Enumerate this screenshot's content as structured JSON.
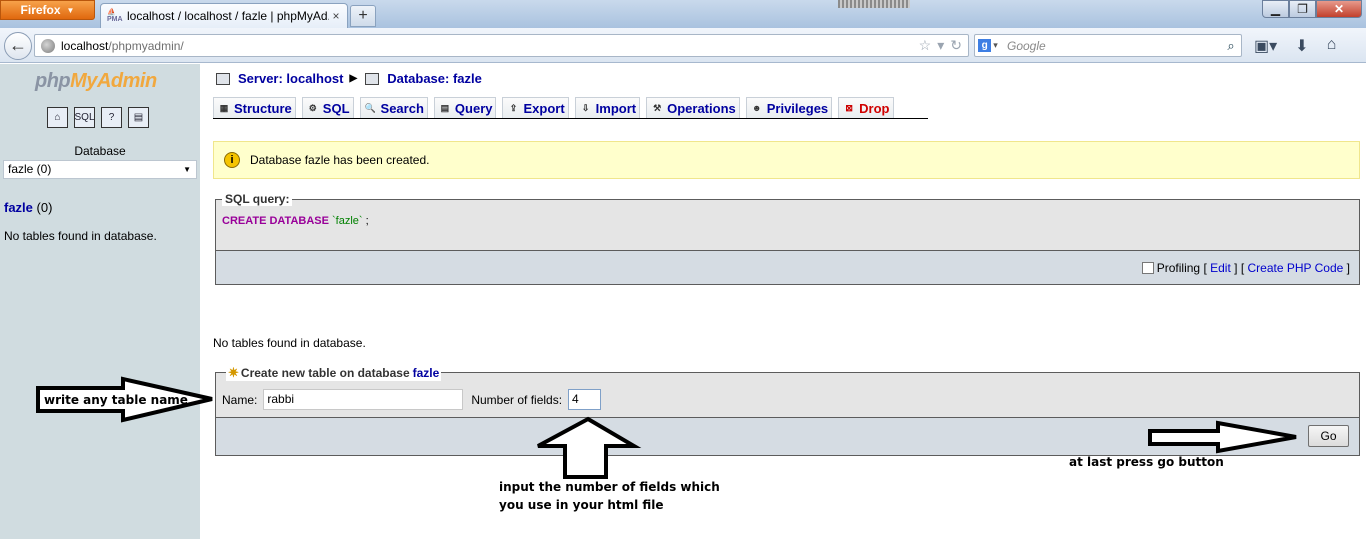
{
  "browser": {
    "app_button": "Firefox",
    "tab_title": "localhost / localhost / fazle | phpMyAd...",
    "new_tab": "+",
    "url_host": "localhost",
    "url_path": "/phpmyadmin/",
    "search_placeholder": "Google",
    "window_controls": [
      "minimize-icon",
      "maximize-icon",
      "close-icon"
    ]
  },
  "sidebar": {
    "logo_php": "php",
    "logo_my": "MyAdmin",
    "icons": [
      "home-icon",
      "sql-icon",
      "query-window-icon",
      "docs-icon"
    ],
    "database_label": "Database",
    "database_selected": "fazle (0)",
    "db_link": "fazle",
    "db_count": "(0)",
    "no_tables": "No tables found in database."
  },
  "breadcrumb": {
    "server": "Server: localhost",
    "database": "Database: fazle"
  },
  "tabs": [
    {
      "label": "Structure",
      "icon": "structure-icon"
    },
    {
      "label": "SQL",
      "icon": "sql-icon"
    },
    {
      "label": "Search",
      "icon": "search-icon"
    },
    {
      "label": "Query",
      "icon": "query-icon"
    },
    {
      "label": "Export",
      "icon": "export-icon"
    },
    {
      "label": "Import",
      "icon": "import-icon"
    },
    {
      "label": "Operations",
      "icon": "operations-icon"
    },
    {
      "label": "Privileges",
      "icon": "privileges-icon"
    },
    {
      "label": "Drop",
      "icon": "drop-icon"
    }
  ],
  "notice": "Database fazle has been created.",
  "sql": {
    "legend": "SQL query:",
    "keyword": "CREATE DATABASE",
    "name": "`fazle`",
    "end": ";",
    "profiling": "Profiling",
    "edit": "Edit",
    "create_php": "Create PHP Code"
  },
  "main_no_tables": "No tables found in database.",
  "create": {
    "legend": "Create new table on database",
    "db": "fazle",
    "name_label": "Name:",
    "name_value": "rabbi",
    "fields_label": "Number of fields:",
    "fields_value": "4",
    "go": "Go"
  },
  "annotations": {
    "name_hint": "write any table name",
    "fields_hint_1": "input the number of fields which",
    "fields_hint_2": "you use in your html file",
    "go_hint": "at last press go button"
  }
}
